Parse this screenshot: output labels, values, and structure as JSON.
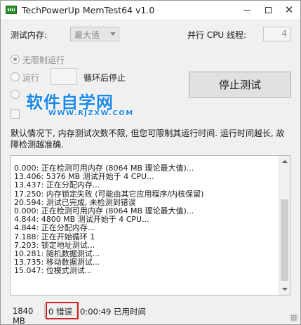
{
  "window": {
    "title": "TechPowerUp MemTest64 v1.0",
    "controls": {
      "minimize": "—",
      "maximize": "□",
      "close": "✕"
    }
  },
  "settings": {
    "memory_label": "测试内存:",
    "memory_value": "最大值",
    "cpu_threads_label": "并行 CPU 线程:",
    "cpu_threads_value": "4",
    "run_unlimited_label": "无限制运行",
    "run_loops_label": "运行",
    "run_loops_value": "",
    "run_loops_suffix": "循环后停止",
    "stop_button_label": "停止测试"
  },
  "watermark": {
    "cn": "软件自学网",
    "url": "WWW.RJZXW.COM"
  },
  "description": "默认情况下, 内存测试次数不限, 但您可限制其运行时间. 运行时间越长, 故障检测越准确.",
  "log": [
    "0.000: 正在检测可用内存 (8064 MB 理论最大值)...",
    "13.406: 5376 MB 测试开始于 4 CPU...",
    "13.437: 正在分配内存...",
    "17.250: 内存锁定失败 (可能由其它应用程序/内核保留)",
    "20.594: 测试已完成, 未检测到错误",
    "0.000: 正在检测可用内存 (8064 MB 理论最大值)...",
    "4.844: 4800 MB 测试开始于 4 CPU...",
    "4.844: 正在分配内存...",
    "7.188: 正在开始循环 1",
    "7.203: 锁定地址测试...",
    "10.281: 随机数据测试...",
    "13.735: 移动数据测试...",
    "15.047: 位模式测试..."
  ],
  "status": {
    "memory": "1840 MB",
    "errors": "0 错误",
    "elapsed": "0:00:49 已用时间"
  },
  "colors": {
    "highlight": "#d42020",
    "watermark": "#1e88e5"
  }
}
